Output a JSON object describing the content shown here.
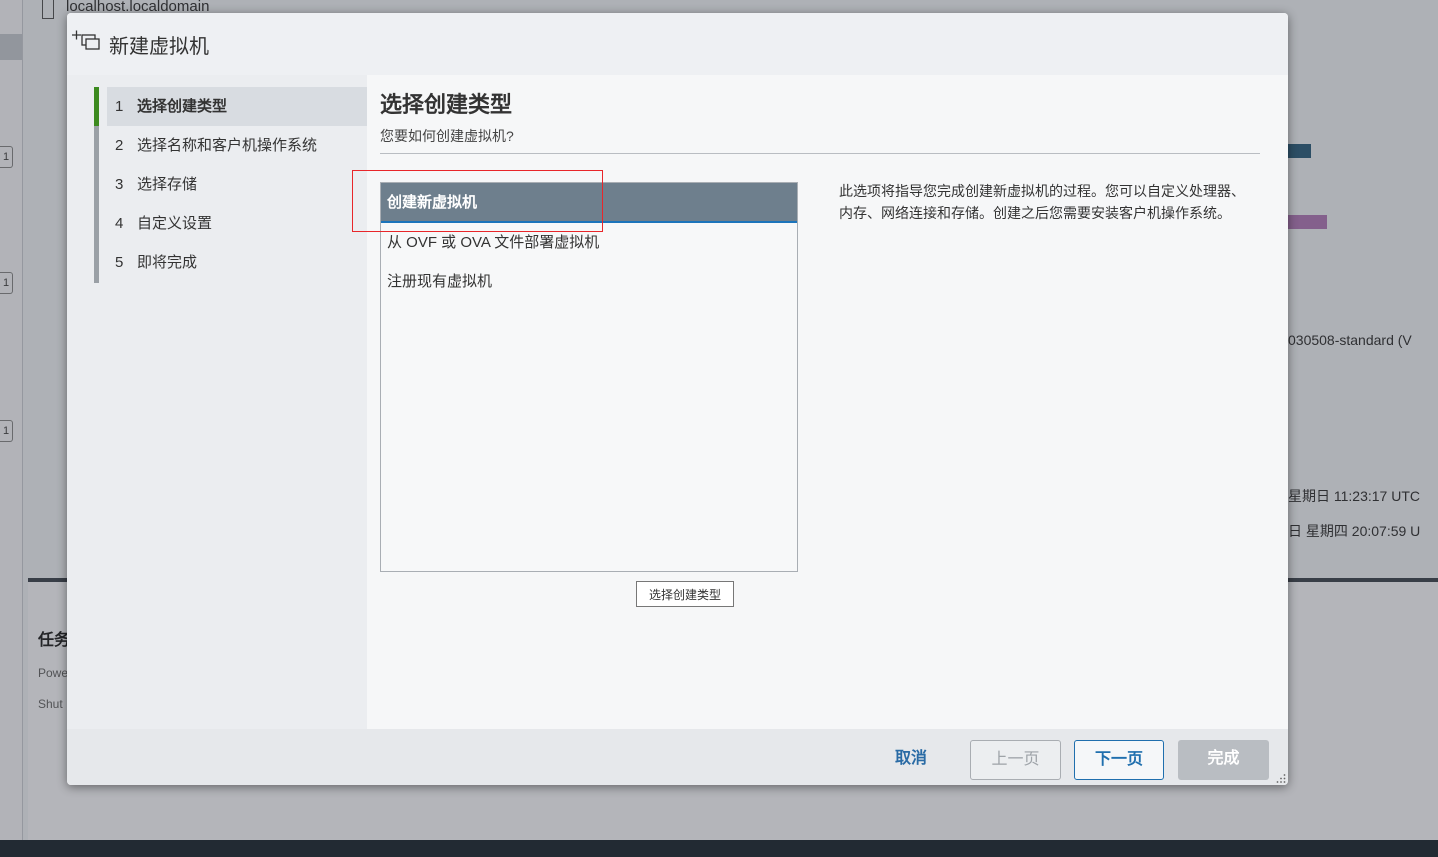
{
  "background": {
    "hostname": "localhost.localdomain",
    "right_texts": [
      "030508-standard (V",
      "星期日 11:23:17 UTC",
      "日 星期四 20:07:59 U"
    ],
    "badges": [
      "1",
      "1",
      "1"
    ],
    "tasks_label": "任务",
    "task_rows": [
      "Powe",
      "Shut"
    ]
  },
  "modal": {
    "title": "新建虚拟机",
    "icon": "new-vm-icon",
    "steps": [
      {
        "num": "1",
        "label": "选择创建类型"
      },
      {
        "num": "2",
        "label": "选择名称和客户机操作系统"
      },
      {
        "num": "3",
        "label": "选择存储"
      },
      {
        "num": "4",
        "label": "自定义设置"
      },
      {
        "num": "5",
        "label": "即将完成"
      }
    ],
    "active_step": 1,
    "heading": "选择创建类型",
    "subheading": "您要如何创建虚拟机?",
    "options": [
      {
        "label": "创建新虚拟机",
        "selected": true
      },
      {
        "label": "从 OVF 或 OVA 文件部署虚拟机",
        "selected": false
      },
      {
        "label": "注册现有虚拟机",
        "selected": false
      }
    ],
    "tooltip": "选择创建类型",
    "description": "此选项将指导您完成创建新虚拟机的过程。您可以自定义处理器、内存、网络连接和存储。创建之后您需要安装客户机操作系统。",
    "buttons": {
      "cancel": "取消",
      "prev": "上一页",
      "next": "下一页",
      "finish": "完成"
    }
  },
  "colors": {
    "active_step_bar": "#3c8a1f",
    "selected_option_bg": "#6e7f8d",
    "primary": "#1f6fae",
    "highlight_box": "#e8262a"
  }
}
